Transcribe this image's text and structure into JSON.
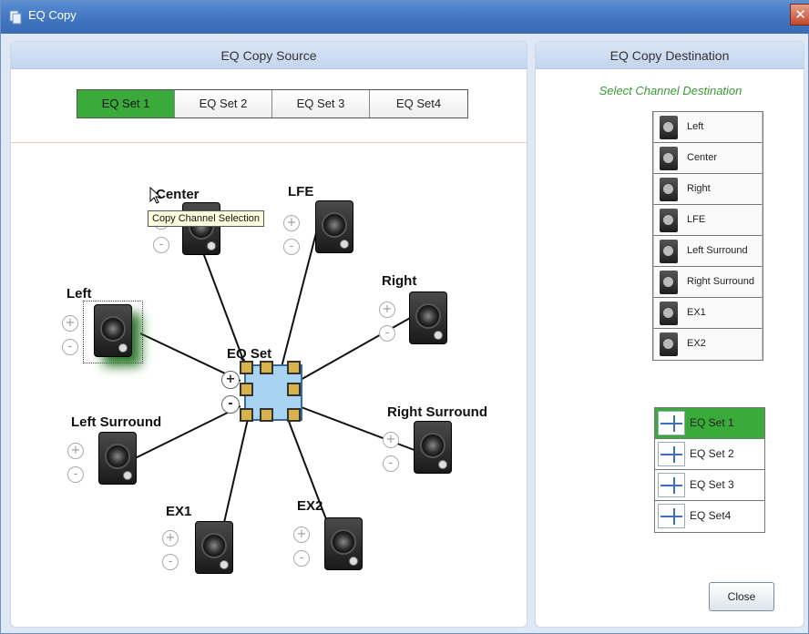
{
  "window": {
    "title": "EQ Copy",
    "close_glyph": "✕"
  },
  "source": {
    "header": "EQ Copy Source",
    "tabs": [
      {
        "label": "EQ Set 1",
        "active": true
      },
      {
        "label": "EQ Set 2",
        "active": false
      },
      {
        "label": "EQ Set 3",
        "active": false
      },
      {
        "label": "EQ Set4",
        "active": false
      }
    ],
    "center_label": "EQ Set",
    "speakers": {
      "center": "Center",
      "lfe": "LFE",
      "left": "Left",
      "right": "Right",
      "left_surround": "Left Surround",
      "right_surround": "Right Surround",
      "ex1": "EX1",
      "ex2": "EX2"
    },
    "plus": "+",
    "minus": "-",
    "tooltip": "Copy Channel Selection"
  },
  "destination": {
    "header": "EQ Copy Destination",
    "subtitle": "Select Channel Destination",
    "channels": [
      "Left",
      "Center",
      "Right",
      "LFE",
      "Left Surround",
      "Right Surround",
      "EX1",
      "EX2"
    ],
    "eq_sets": [
      "EQ Set 1",
      "EQ Set 2",
      "EQ Set 3",
      "EQ Set4"
    ],
    "selected_eq_set": "EQ Set 1",
    "close_label": "Close"
  },
  "colors": {
    "accent_green": "#3aab3a",
    "title_blue": "#3f74c0",
    "eq_box": "#a8d4f2"
  }
}
